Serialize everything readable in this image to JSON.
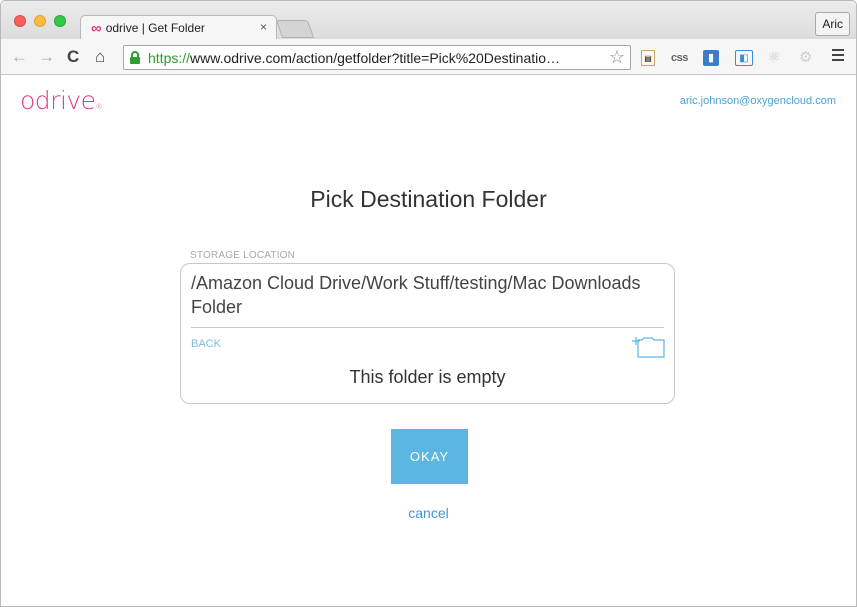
{
  "browser": {
    "tab": {
      "favicon": "∞",
      "title": "odrive | Get Folder",
      "close": "×"
    },
    "profile_label": "Aric",
    "url": {
      "scheme": "https://",
      "rest": "www.odrive.com/action/getfolder?title=Pick%20Destinatio…"
    },
    "icons": {
      "back": "←",
      "forward": "→",
      "reload": "C",
      "home": "⌂",
      "star": "☆",
      "ext_css": "css",
      "ext_atom": "⚛",
      "ext_gear": "⚙"
    }
  },
  "page": {
    "logo": "odrive",
    "logo_mark": "®",
    "user_email": "aric.johnson@oxygencloud.com",
    "heading": "Pick Destination Folder",
    "storage_label": "STORAGE LOCATION",
    "current_path": "/Amazon Cloud Drive/Work Stuff/testing/Mac Downloads Folder",
    "back_label": "BACK",
    "empty_message": "This folder is empty",
    "okay_label": "OKAY",
    "cancel_label": "cancel"
  },
  "colors": {
    "brand": "#e0398b",
    "link": "#4aa3d6",
    "button": "#5bb6e2"
  }
}
